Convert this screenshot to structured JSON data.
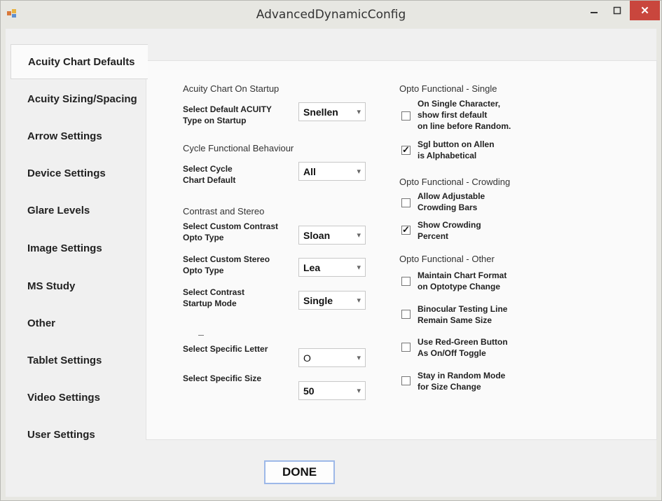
{
  "window": {
    "title": "AdvancedDynamicConfig",
    "controls": {
      "minimize": "–",
      "maximize": "□",
      "close": "✕"
    }
  },
  "tabs": [
    {
      "label": "Acuity Chart Defaults",
      "active": true
    },
    {
      "label": "Acuity Sizing/Spacing"
    },
    {
      "label": "Arrow Settings"
    },
    {
      "label": "Device Settings"
    },
    {
      "label": "Glare Levels"
    },
    {
      "label": "Image Settings"
    },
    {
      "label": "MS Study"
    },
    {
      "label": "Other"
    },
    {
      "label": "Tablet Settings"
    },
    {
      "label": "Video Settings"
    },
    {
      "label": "User Settings"
    }
  ],
  "left": {
    "group1": "Acuity Chart On Startup",
    "acuity_type_label": [
      "Select Default ACUITY",
      "Type on Startup"
    ],
    "acuity_type_value": "Snellen",
    "group2": "Cycle Functional Behaviour",
    "cycle_label": [
      "Select Cycle",
      "Chart Default"
    ],
    "cycle_value": "All",
    "group3": "Contrast and Stereo",
    "contrast_label": [
      "Select Custom Contrast",
      "Opto Type"
    ],
    "contrast_value": "Sloan",
    "stereo_label": [
      "Select Custom Stereo",
      "Opto Type"
    ],
    "stereo_value": "Lea",
    "startup_label": [
      "Select Contrast",
      "Startup Mode"
    ],
    "startup_value": "Single",
    "letter_label": "Select Specific Letter",
    "letter_value": "O",
    "size_label": "Select Specific Size",
    "size_value": "50"
  },
  "right": {
    "group1": "Opto Functional - Single",
    "single_char": {
      "lines": [
        "On Single Character,",
        "show first default",
        "on line before Random."
      ],
      "checked": false
    },
    "sgl_allen": {
      "lines": [
        "Sgl button on Allen",
        "is Alphabetical"
      ],
      "checked": true
    },
    "group2": "Opto Functional - Crowding",
    "adj_crowding": {
      "lines": [
        "Allow Adjustable",
        "Crowding Bars"
      ],
      "checked": false
    },
    "show_crowding": {
      "lines": [
        "Show Crowding",
        "Percent"
      ],
      "checked": true
    },
    "group3": "Opto Functional - Other",
    "maintain_format": {
      "lines": [
        "Maintain Chart Format",
        "on Optotype Change"
      ],
      "checked": false
    },
    "binocular": {
      "lines": [
        "Binocular Testing Line",
        "Remain Same Size"
      ],
      "checked": false
    },
    "red_green": {
      "lines": [
        "Use Red-Green Button",
        "As On/Off Toggle"
      ],
      "checked": false
    },
    "random_mode": {
      "lines": [
        "Stay in Random Mode",
        "for Size Change"
      ],
      "checked": false
    }
  },
  "done_label": "DONE"
}
